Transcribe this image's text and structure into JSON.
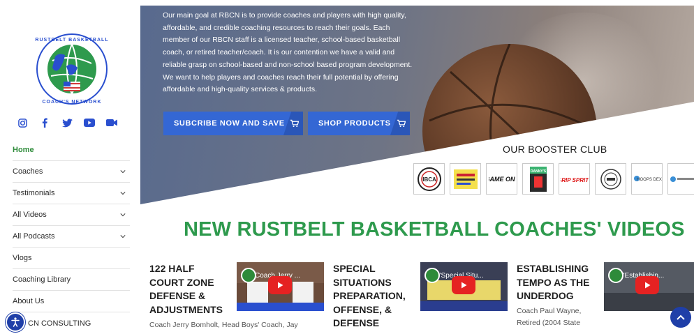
{
  "sidebar": {
    "logo": {
      "text_top": "RUSTBELT BASKETBALL",
      "text_bottom": "COACH'S NETWORK"
    },
    "socials": [
      "instagram-icon",
      "facebook-icon",
      "twitter-icon",
      "youtube-icon",
      "video-camera-icon"
    ],
    "nav": [
      {
        "label": "Home",
        "active": true,
        "has_submenu": false
      },
      {
        "label": "Coaches",
        "has_submenu": true
      },
      {
        "label": "Testimonials",
        "has_submenu": true
      },
      {
        "label": "All Videos",
        "has_submenu": true
      },
      {
        "label": "All Podcasts",
        "has_submenu": true
      },
      {
        "label": "Vlogs",
        "has_submenu": false
      },
      {
        "label": "Coaching Library",
        "has_submenu": false
      },
      {
        "label": "About Us",
        "has_submenu": false
      },
      {
        "label": "CN CONSULTING",
        "has_submenu": false
      }
    ]
  },
  "hero": {
    "text": "Our main goal at RBCN is to provide coaches and players with high quality, affordable, and credible coaching resources to reach their goals. Each member of our RBCN staff is a licensed teacher, school-based basketball coach, or retired teacher/coach. It is our contention we have a valid and reliable grasp on school-based and non-school based program development. We want to help players and coaches reach their full potential by offering affordable and high-quality services & products.",
    "cta_primary": "SUBCRIBE NOW AND SAVE",
    "cta_secondary": "SHOP PRODUCTS"
  },
  "booster": {
    "title": "OUR BOOSTER CLUB",
    "logos": [
      "IBCA",
      "",
      "GAME ONE",
      "DANNY'S",
      "GRIP SPRITZ",
      "",
      "HOOPS DEX",
      ""
    ]
  },
  "videos": {
    "title": "NEW RUSTBELT BASKETBALL COACHES' VIDEOS",
    "items": [
      {
        "title": "122 HALF COURT ZONE DEFENSE & ADJUSTMENTS",
        "subtitle": "Coach Jerry Bomholt, Head Boys' Coach, Jay",
        "thumb_caption": "Coach Jerry ..."
      },
      {
        "title": "SPECIAL SITUATIONS PREPARATION, OFFENSE, & DEFENSE",
        "subtitle": "",
        "thumb_caption": "\"Special Situ..."
      },
      {
        "title": "ESTABLISHING TEMPO AS THE UNDERDOG",
        "subtitle": "Coach Paul Wayne, Retired (2004 State",
        "thumb_caption": "\"Establishin..."
      }
    ]
  },
  "colors": {
    "accent_blue": "#3467d4",
    "brand_green": "#2e9a4d",
    "nav_active": "#2e8b3a"
  }
}
